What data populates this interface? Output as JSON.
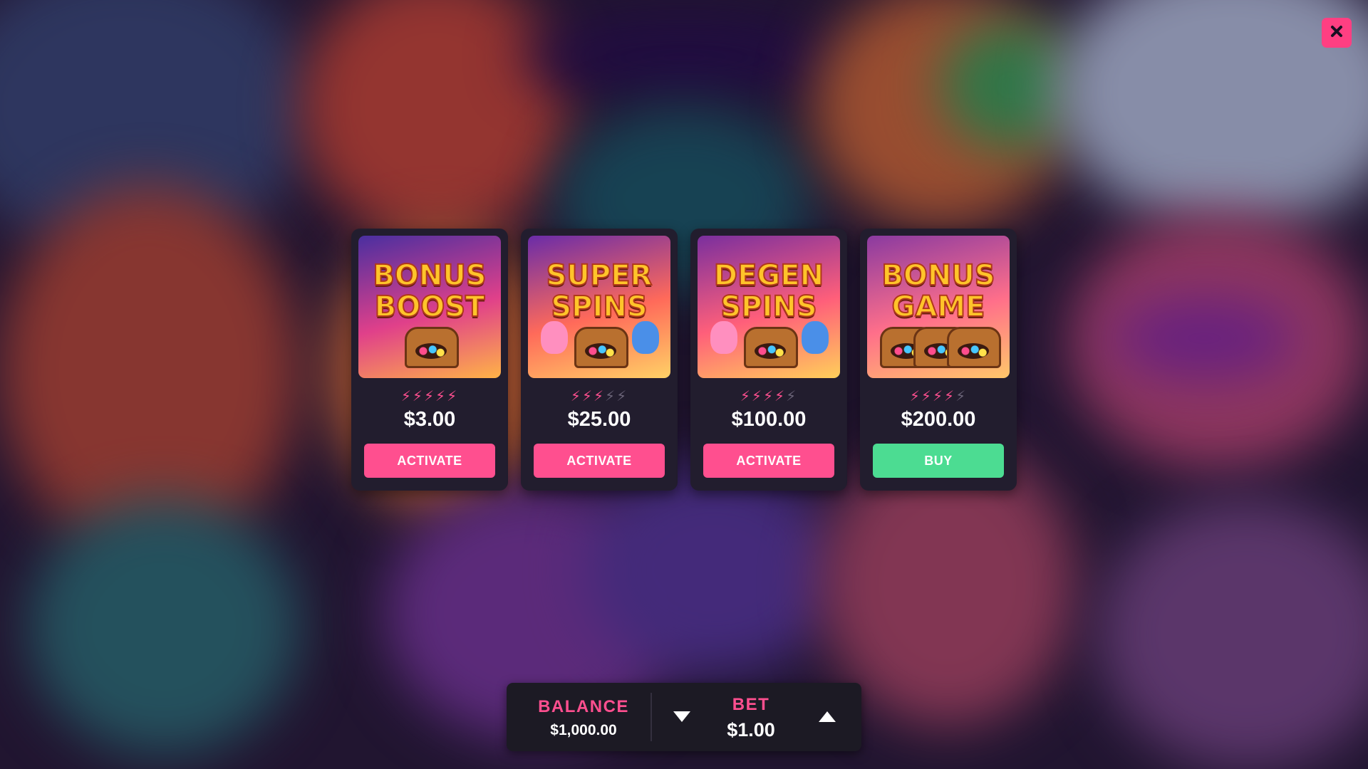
{
  "close": {
    "icon": "close-icon"
  },
  "features": [
    {
      "art_line1": "BONUS",
      "art_line2": "BOOST",
      "rating_max": 5,
      "rating": 5,
      "price": "$3.00",
      "button_label": "ACTIVATE",
      "button_color": "#ff4f8f",
      "art_colors": [
        "#4a2fa0",
        "#e0408a",
        "#ffb347"
      ]
    },
    {
      "art_line1": "SUPER",
      "art_line2": "SPINS",
      "rating_max": 5,
      "rating": 3,
      "price": "$25.00",
      "button_label": "ACTIVATE",
      "button_color": "#ff4f8f",
      "art_colors": [
        "#6a2ca8",
        "#ff6a5a",
        "#ffd166"
      ]
    },
    {
      "art_line1": "DEGEN",
      "art_line2": "SPINS",
      "rating_max": 5,
      "rating": 4,
      "price": "$100.00",
      "button_label": "ACTIVATE",
      "button_color": "#ff4f8f",
      "art_colors": [
        "#7a2f9e",
        "#ff5f7a",
        "#ffcf5a"
      ]
    },
    {
      "art_line1": "BONUS",
      "art_line2": "GAME",
      "rating_max": 5,
      "rating": 4,
      "price": "$200.00",
      "button_label": "BUY",
      "button_color": "#4cdc92",
      "art_colors": [
        "#8a3aa0",
        "#ff6f8a",
        "#ffc76a"
      ]
    }
  ],
  "bottom_bar": {
    "balance_label": "BALANCE",
    "balance_value": "$1,000.00",
    "bet_label": "BET",
    "bet_value": "$1.00",
    "bet_down_icon": "triangle-down-icon",
    "bet_up_icon": "triangle-up-icon"
  },
  "colors": {
    "accent": "#ff4f8f",
    "buy": "#4cdc92",
    "card": "#221d2e",
    "bar": "#1c1a24"
  }
}
